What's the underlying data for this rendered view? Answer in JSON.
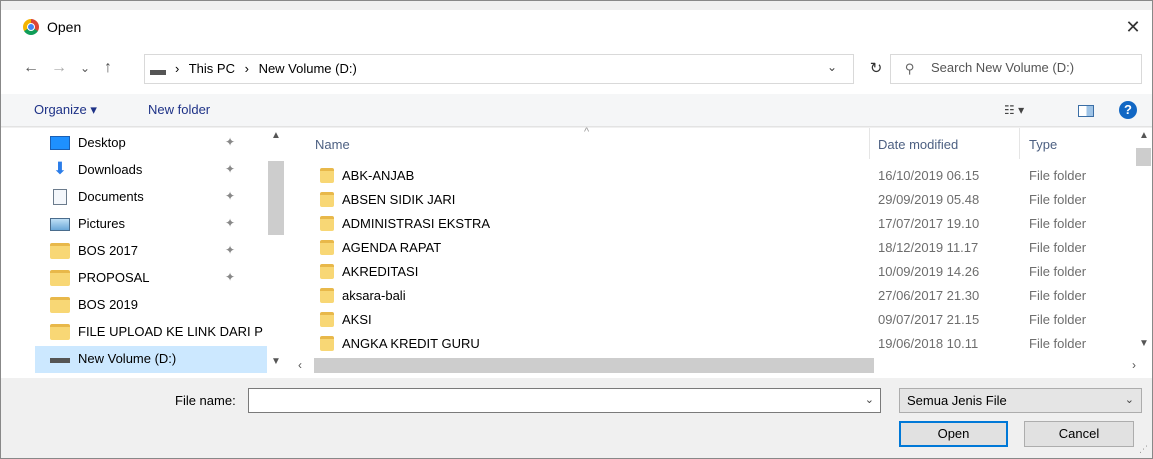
{
  "window": {
    "title": "Open",
    "close_symbol": "✕"
  },
  "nav": {
    "back": "←",
    "forward": "→",
    "recent": "⌄",
    "up": "↑",
    "breadcrumbs": [
      "This PC",
      "New Volume (D:)"
    ],
    "separator": "›",
    "refresh": "↻",
    "search_placeholder": "Search New Volume (D:)"
  },
  "toolbar": {
    "organize": "Organize ▾",
    "new_folder": "New folder",
    "help": "?"
  },
  "sidebar": {
    "items": [
      {
        "label": "Desktop",
        "icon": "desktop-icon",
        "pinned": true
      },
      {
        "label": "Downloads",
        "icon": "downloads-icon",
        "pinned": true
      },
      {
        "label": "Documents",
        "icon": "documents-icon",
        "pinned": true
      },
      {
        "label": "Pictures",
        "icon": "pictures-icon",
        "pinned": true
      },
      {
        "label": "BOS 2017",
        "icon": "folder-icon",
        "pinned": true
      },
      {
        "label": "PROPOSAL",
        "icon": "folder-icon",
        "pinned": true
      },
      {
        "label": "BOS 2019",
        "icon": "folder-icon",
        "pinned": false
      },
      {
        "label": "FILE UPLOAD KE LINK DARI P",
        "icon": "folder-icon",
        "pinned": false
      },
      {
        "label": "New Volume (D:)",
        "icon": "drive-icon",
        "pinned": false,
        "selected": true
      }
    ],
    "pin_symbol": "📌"
  },
  "filelist": {
    "columns": {
      "name": "Name",
      "date": "Date modified",
      "type": "Type"
    },
    "rows": [
      {
        "name": "ABK-ANJAB",
        "date": "16/10/2019 06.15",
        "type": "File folder"
      },
      {
        "name": "ABSEN SIDIK JARI",
        "date": "29/09/2019 05.48",
        "type": "File folder"
      },
      {
        "name": "ADMINISTRASI EKSTRA",
        "date": "17/07/2017 19.10",
        "type": "File folder"
      },
      {
        "name": "AGENDA RAPAT",
        "date": "18/12/2019 11.17",
        "type": "File folder"
      },
      {
        "name": "AKREDITASI",
        "date": "10/09/2019 14.26",
        "type": "File folder"
      },
      {
        "name": "aksara-bali",
        "date": "27/06/2017 21.30",
        "type": "File folder"
      },
      {
        "name": "AKSI",
        "date": "09/07/2017 21.15",
        "type": "File folder"
      },
      {
        "name": "ANGKA KREDIT GURU",
        "date": "19/06/2018 10.11",
        "type": "File folder"
      }
    ]
  },
  "footer": {
    "file_name_label": "File name:",
    "file_name_value": "",
    "filter_value": "Semua Jenis File",
    "open_label": "Open",
    "cancel_label": "Cancel"
  },
  "colors": {
    "accent": "#0078d7",
    "selection": "#cce8ff",
    "folder": "#f8d775",
    "link": "#1e3287"
  }
}
